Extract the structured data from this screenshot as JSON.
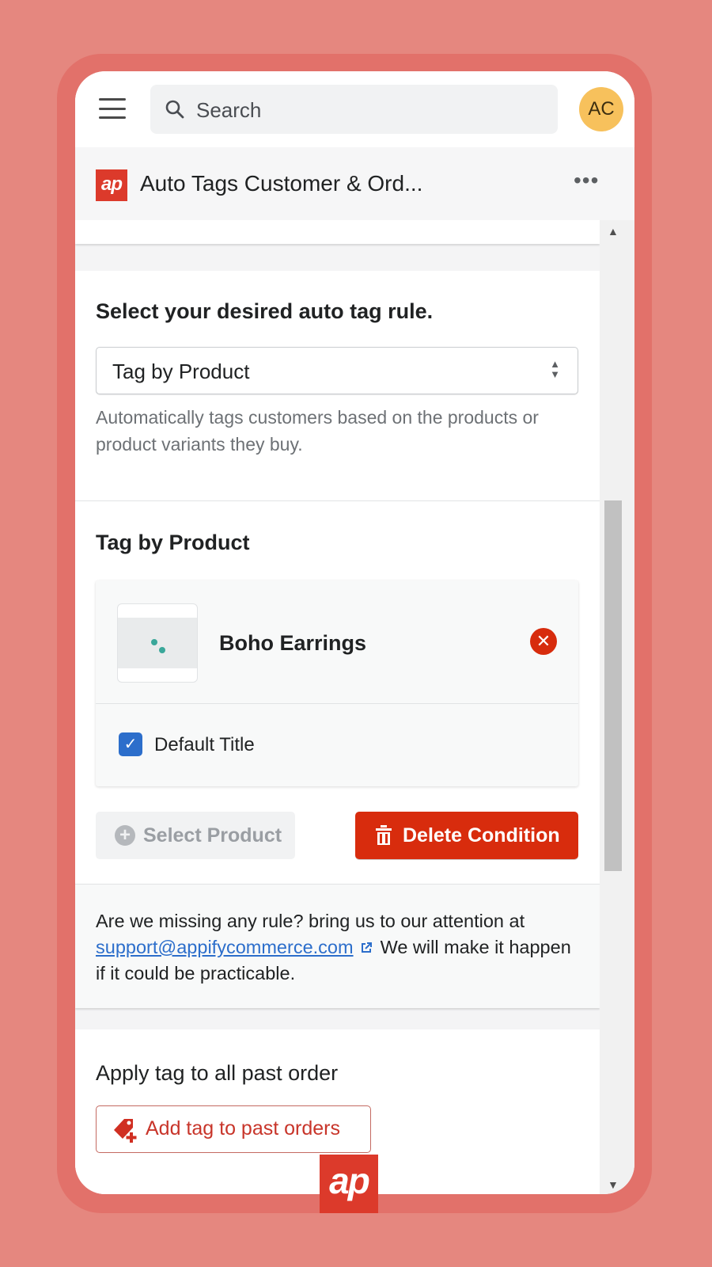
{
  "topbar": {
    "search_placeholder": "Search",
    "avatar_initials": "AC",
    "avatar_color": "#f7c15c"
  },
  "app": {
    "logo_text": "ap",
    "title": "Auto Tags Customer & Ord...",
    "more_label": "•••",
    "brand_color": "#dc3a2b"
  },
  "rule_section": {
    "heading": "Select your desired auto tag rule.",
    "selected_rule": "Tag by Product",
    "help_text": "Automatically tags customers based on the products or product variants they buy."
  },
  "product_section": {
    "heading": "Tag by Product",
    "products": [
      {
        "name": "Boho Earrings",
        "variants": [
          {
            "label": "Default Title",
            "checked": true
          }
        ]
      }
    ],
    "select_product_label": "Select Product",
    "delete_condition_label": "Delete Condition",
    "delete_color": "#d82c0d"
  },
  "support_note": {
    "text_before": "Are we missing any rule? bring us to our attention at ",
    "email": "support@appifycommerce.com",
    "text_after": "We will make it happen if it could be practicable."
  },
  "past_orders": {
    "heading": "Apply tag to all past order",
    "button_label": "Add tag to past orders"
  },
  "badge": {
    "text": "ap"
  },
  "icons": {
    "menu": "hamburger-icon",
    "search": "search-icon",
    "more": "more-horizontal-icon",
    "select_arrows": "select-chevrons-icon",
    "remove": "remove-circle-icon",
    "check": "checkmark-icon",
    "add": "plus-circle-icon",
    "delete": "trash-icon",
    "external": "external-link-icon",
    "tag_add": "tag-plus-icon",
    "scroll_up": "scroll-up-arrow-icon",
    "scroll_down": "scroll-down-arrow-icon"
  }
}
